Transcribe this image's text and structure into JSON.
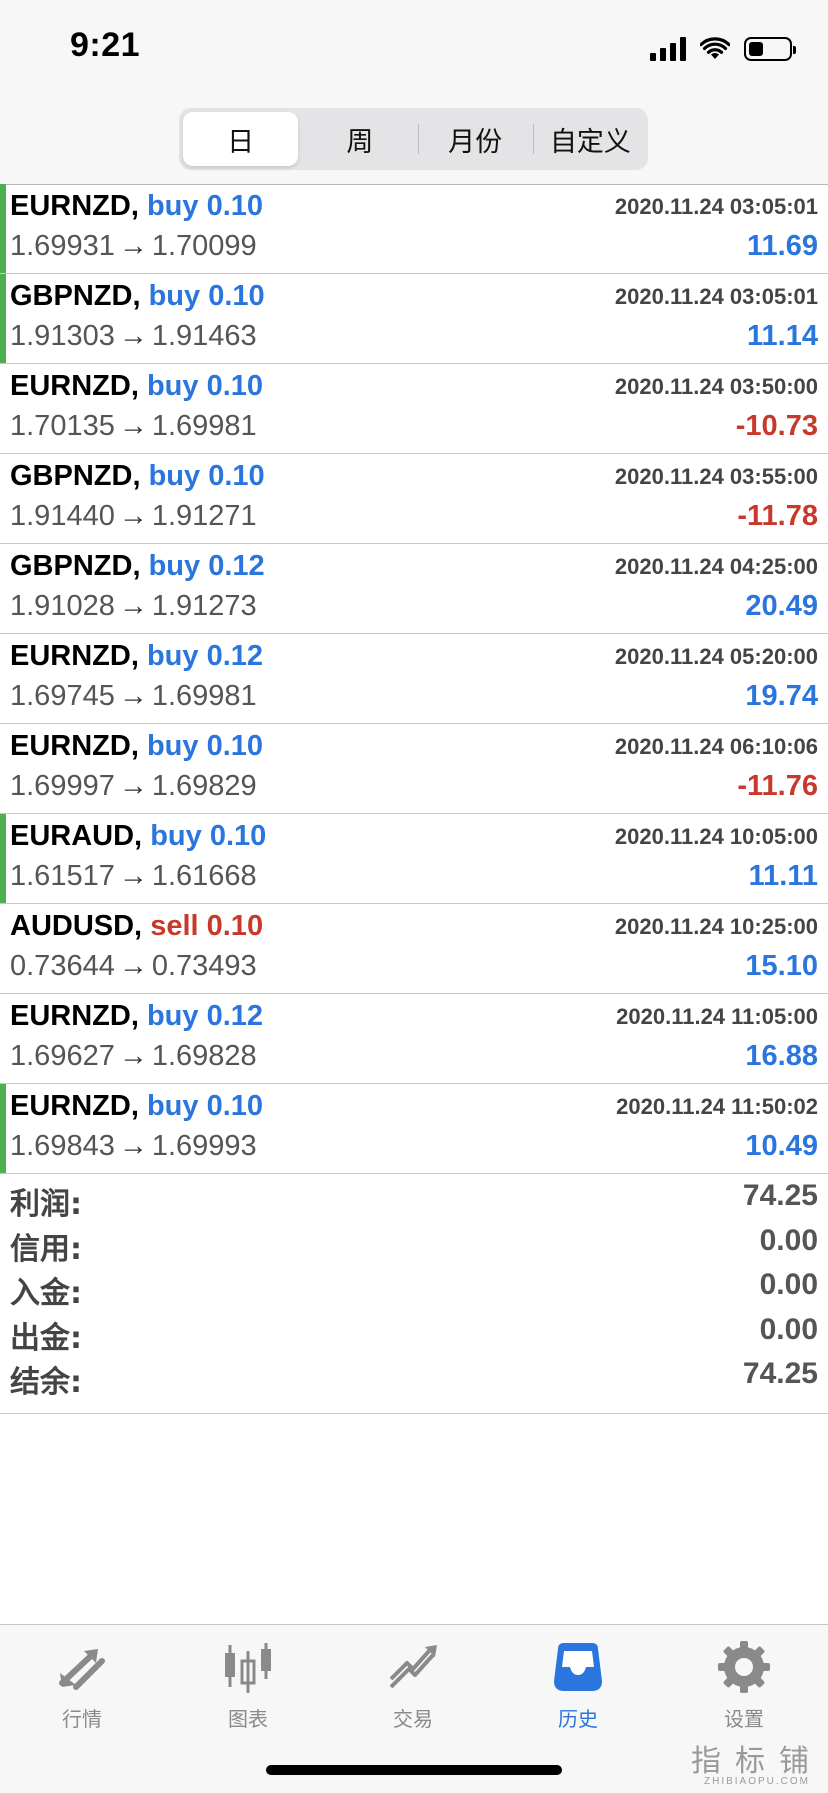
{
  "status_bar": {
    "time": "9:21"
  },
  "tabs": [
    {
      "label": "日",
      "active": true
    },
    {
      "label": "周"
    },
    {
      "label": "月份"
    },
    {
      "label": "自定义"
    }
  ],
  "trades": [
    {
      "symbol": "EURNZD,",
      "side": "buy",
      "lot": "0.10",
      "open": "1.69931",
      "close": "1.70099",
      "time": "2020.11.24 03:05:01",
      "profit": "11.69",
      "marked": true
    },
    {
      "symbol": "GBPNZD,",
      "side": "buy",
      "lot": "0.10",
      "open": "1.91303",
      "close": "1.91463",
      "time": "2020.11.24 03:05:01",
      "profit": "11.14",
      "marked": true
    },
    {
      "symbol": "EURNZD,",
      "side": "buy",
      "lot": "0.10",
      "open": "1.70135",
      "close": "1.69981",
      "time": "2020.11.24 03:50:00",
      "profit": "-10.73",
      "marked": false
    },
    {
      "symbol": "GBPNZD,",
      "side": "buy",
      "lot": "0.10",
      "open": "1.91440",
      "close": "1.91271",
      "time": "2020.11.24 03:55:00",
      "profit": "-11.78",
      "marked": false
    },
    {
      "symbol": "GBPNZD,",
      "side": "buy",
      "lot": "0.12",
      "open": "1.91028",
      "close": "1.91273",
      "time": "2020.11.24 04:25:00",
      "profit": "20.49",
      "marked": false
    },
    {
      "symbol": "EURNZD,",
      "side": "buy",
      "lot": "0.12",
      "open": "1.69745",
      "close": "1.69981",
      "time": "2020.11.24 05:20:00",
      "profit": "19.74",
      "marked": false
    },
    {
      "symbol": "EURNZD,",
      "side": "buy",
      "lot": "0.10",
      "open": "1.69997",
      "close": "1.69829",
      "time": "2020.11.24 06:10:06",
      "profit": "-11.76",
      "marked": false
    },
    {
      "symbol": "EURAUD,",
      "side": "buy",
      "lot": "0.10",
      "open": "1.61517",
      "close": "1.61668",
      "time": "2020.11.24 10:05:00",
      "profit": "11.11",
      "marked": true
    },
    {
      "symbol": "AUDUSD,",
      "side": "sell",
      "lot": "0.10",
      "open": "0.73644",
      "close": "0.73493",
      "time": "2020.11.24 10:25:00",
      "profit": "15.10",
      "marked": false
    },
    {
      "symbol": "EURNZD,",
      "side": "buy",
      "lot": "0.12",
      "open": "1.69627",
      "close": "1.69828",
      "time": "2020.11.24 11:05:00",
      "profit": "16.88",
      "marked": false
    },
    {
      "symbol": "EURNZD,",
      "side": "buy",
      "lot": "0.10",
      "open": "1.69843",
      "close": "1.69993",
      "time": "2020.11.24 11:50:02",
      "profit": "10.49",
      "marked": true
    }
  ],
  "arrow": "→",
  "summary": [
    {
      "label": "利润:",
      "value": "74.25"
    },
    {
      "label": "信用:",
      "value": "0.00"
    },
    {
      "label": "入金:",
      "value": "0.00"
    },
    {
      "label": "出金:",
      "value": "0.00"
    },
    {
      "label": "结余:",
      "value": "74.25"
    }
  ],
  "tab_bar": [
    {
      "label": "行情",
      "icon": "quotes-arrows-icon"
    },
    {
      "label": "图表",
      "icon": "candlestick-chart-icon"
    },
    {
      "label": "交易",
      "icon": "trade-trend-icon"
    },
    {
      "label": "历史",
      "icon": "history-inbox-icon",
      "active": true
    },
    {
      "label": "设置",
      "icon": "settings-gear-icon"
    }
  ],
  "watermark": {
    "main": "指标铺",
    "sub": "ZHIBIAOPU.COM"
  },
  "colors": {
    "accent": "#2a75de",
    "negative": "#c8392b",
    "marker": "#4caf50"
  }
}
